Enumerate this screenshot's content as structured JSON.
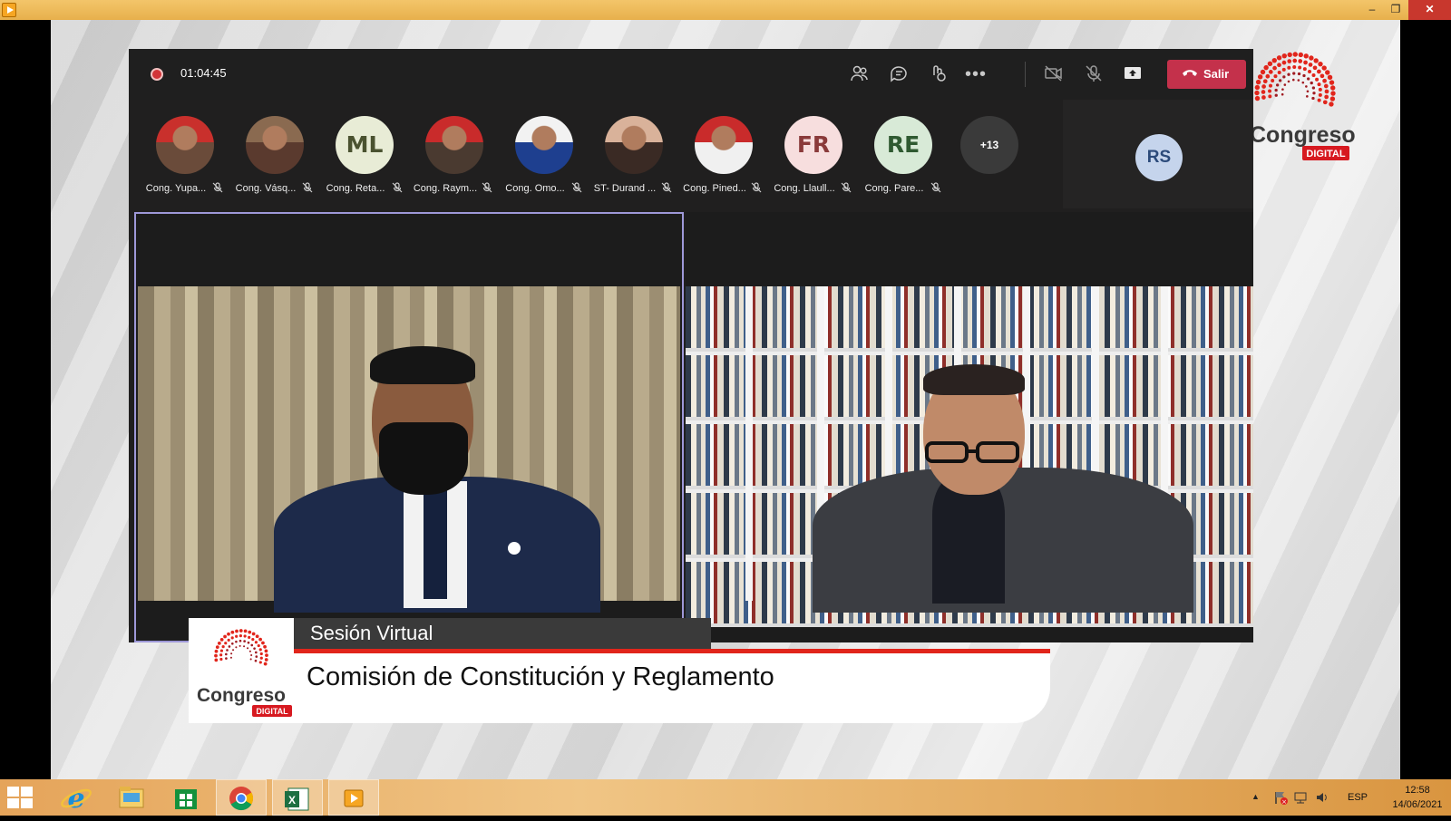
{
  "window": {
    "minimize": "–",
    "maximize": "❐",
    "close": "✕"
  },
  "call": {
    "timer": "01:04:45",
    "leave_label": "Salir"
  },
  "participants": [
    {
      "name": "Cong. Yupa...",
      "kind": "photo"
    },
    {
      "name": "Cong. Vásq...",
      "kind": "photo"
    },
    {
      "name": "Cong. Reta...",
      "kind": "initials",
      "initials": "ML",
      "bg": "#e8ecd6",
      "fg": "#4a5230"
    },
    {
      "name": "Cong. Raym...",
      "kind": "photo"
    },
    {
      "name": "Cong. Omo...",
      "kind": "photo"
    },
    {
      "name": "ST- Durand ...",
      "kind": "photo"
    },
    {
      "name": "Cong. Pined...",
      "kind": "photo"
    },
    {
      "name": "Cong. Llaull...",
      "kind": "initials",
      "initials": "FR",
      "bg": "#f7dede",
      "fg": "#8a3a3a"
    },
    {
      "name": "Cong. Pare...",
      "kind": "initials",
      "initials": "RE",
      "bg": "#d8ead7",
      "fg": "#2f5a31"
    }
  ],
  "more_participants": "+13",
  "self_view": {
    "initials": "RS"
  },
  "brand": {
    "name": "Congreso",
    "badge": "DIGITAL"
  },
  "lower_third": {
    "session": "Sesión Virtual",
    "title": "Comisión de Constitución y Reglamento",
    "logo_name": "Congreso",
    "logo_badge": "DIGITAL"
  },
  "taskbar": {
    "lang": "ESP",
    "time": "12:58",
    "date": "14/06/2021"
  },
  "colors": {
    "leave": "#c4314b",
    "accent_red": "#e1251b",
    "speaker_border": "#9e98d8"
  }
}
